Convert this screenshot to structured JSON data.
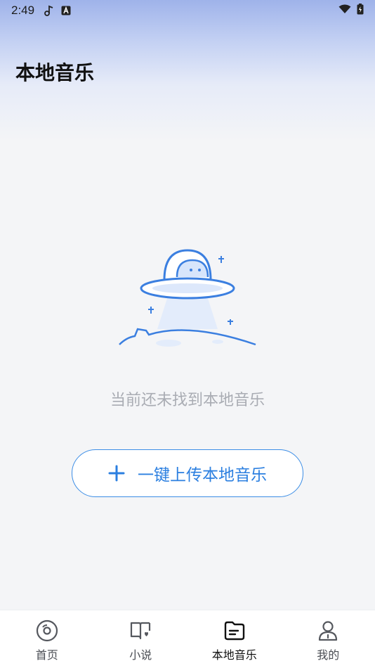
{
  "status_bar": {
    "time": "2:49",
    "icons": [
      "music-note-icon",
      "app-a-icon",
      "wifi-icon",
      "battery-charging-icon"
    ]
  },
  "header": {
    "title": "本地音乐"
  },
  "empty_state": {
    "illustration": "ufo-icon",
    "message": "当前还未找到本地音乐"
  },
  "upload": {
    "label": "一键上传本地音乐",
    "icon": "plus-icon",
    "accent_color": "#2b7fe0"
  },
  "tab_bar": {
    "items": [
      {
        "label": "首页",
        "icon": "disc-icon",
        "active": false
      },
      {
        "label": "小说",
        "icon": "book-icon",
        "active": false
      },
      {
        "label": "本地音乐",
        "icon": "folder-music-icon",
        "active": true
      },
      {
        "label": "我的",
        "icon": "user-icon",
        "active": false
      }
    ]
  }
}
